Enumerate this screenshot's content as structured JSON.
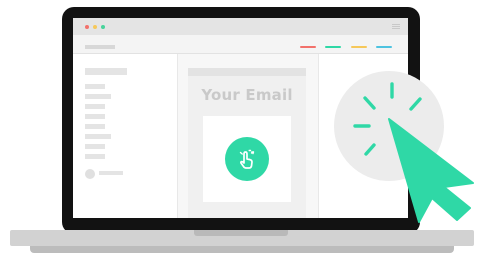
{
  "editor": {
    "email_title": "Your Email"
  },
  "titlebar": {
    "window_controls": [
      {
        "name": "close",
        "color": "#f2716b"
      },
      {
        "name": "minimize",
        "color": "#f6c85a"
      },
      {
        "name": "maximize",
        "color": "#47d39b"
      }
    ]
  },
  "toolbar": {
    "accent_swatches": [
      "#f2716b",
      "#2fd8a6",
      "#f6c85a",
      "#4ec3e0"
    ]
  },
  "colors": {
    "accent": "#2fd8a6",
    "laptop_frame": "#121212"
  },
  "icons": {
    "drop_target": "hand-pointer-icon",
    "cursor": "mouse-pointer-icon",
    "click_burst": "click-burst-icon"
  }
}
